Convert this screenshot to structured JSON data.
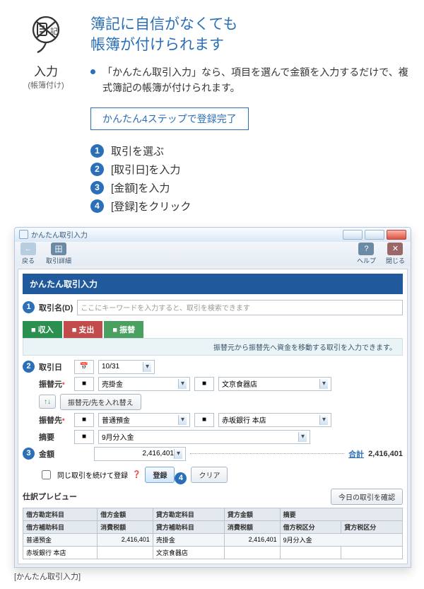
{
  "hero": {
    "label": "入力",
    "sublabel": "(帳簿付け)",
    "title_line1": "簿記に自信がなくても",
    "title_line2": "帳簿が付けられます",
    "desc": "「かんたん取引入力」なら、項目を選んで金額を入力するだけで、複式簿記の帳簿が付けられます。",
    "chip": "かんたん4ステップで登録完了"
  },
  "steps": [
    "取引を選ぶ",
    "[取引日]を入力",
    "[金額]を入力",
    "[登録]をクリック"
  ],
  "app": {
    "window_title": "かんたん取引入力",
    "toolbar_left": "戻る",
    "toolbar_left_sub": "取引詳細",
    "toolbar_right_1": "ヘルプ",
    "toolbar_right_2": "閉じる",
    "blue_band": "かんたん取引入力",
    "search_label": "取引名(D)",
    "search_placeholder": "ここにキーワードを入力すると、取引を検索できます",
    "tabs": {
      "income": "収入",
      "expense": "支出",
      "transfer": "振替"
    },
    "hint_bar": "振替元から振替先へ資金を移動する取引を入力できます。",
    "form": {
      "date_label": "取引日",
      "date_value": "10/31",
      "src_label": "振替元",
      "src_label_req": "*",
      "src_account": "売掛金",
      "src_shop": "文京食器店",
      "swap_label": "振替元/先を入れ替え",
      "dst_label": "振替先",
      "dst_label_req": "*",
      "dst_account": "普通預金",
      "dst_aux": "赤坂銀行 本店",
      "remark_label": "摘要",
      "remark_value": "9月分入金",
      "amount_label": "金額",
      "amount_value": "2,416,401",
      "total_label": "合計",
      "total_value": "2,416,401",
      "same_checkbox": "同じ取引を続けて登録",
      "register_btn": "登録",
      "clear_btn": "クリア",
      "today_btn": "今日の取引を確認",
      "preview_label": "仕訳プレビュー"
    },
    "table": {
      "row1": [
        "借方勘定科目",
        "借方金額",
        "貸方勘定科目",
        "貸方金額",
        "摘要"
      ],
      "row2": [
        "借方補助科目",
        "消費税額",
        "貸方補助科目",
        "消費税額",
        "借方税区分",
        "貸方税区分"
      ],
      "row3": [
        "普通預金",
        "2,416,401",
        "売掛金",
        "2,416,401",
        "9月分入金"
      ],
      "row4": [
        "赤坂銀行 本店",
        "",
        "文京食器店",
        "",
        "",
        ""
      ]
    }
  },
  "caption": "[かんたん取引入力]"
}
